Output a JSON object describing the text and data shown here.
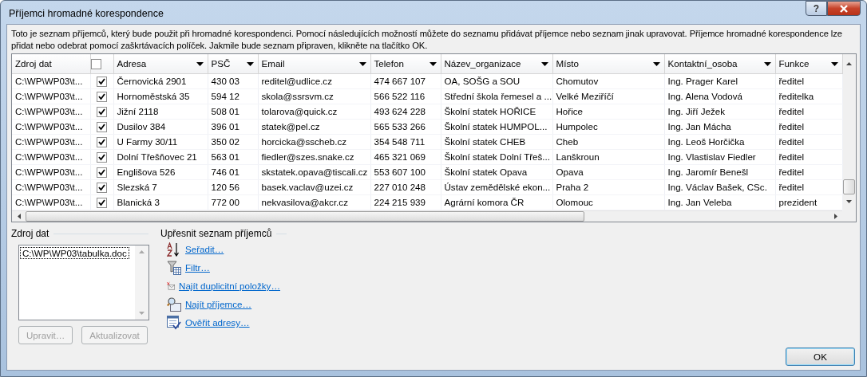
{
  "window": {
    "title": "Příjemci hromadné korespondence",
    "help_button": "?"
  },
  "description": "Toto je seznam příjemců, který bude použit při hromadné korespondenci. Pomocí následujících možností můžete do seznamu přidávat příjemce nebo seznam jinak upravovat. Příjemce hromadné korespondence lze přidat nebo odebrat pomocí zaškrtávacích políček. Jakmile bude seznam připraven, klikněte na tlačítko OK.",
  "table": {
    "columns": [
      {
        "kind": "plain",
        "label": "Zdroj dat"
      },
      {
        "kind": "check",
        "checked": false
      },
      {
        "kind": "filter",
        "label": "Adresa"
      },
      {
        "kind": "filter",
        "label": "PSČ"
      },
      {
        "kind": "filter",
        "label": "Email"
      },
      {
        "kind": "filter",
        "label": "Telefon"
      },
      {
        "kind": "filter",
        "label": "Název_organizace"
      },
      {
        "kind": "filter",
        "label": "Místo"
      },
      {
        "kind": "filter",
        "label": "Kontaktní_osoba"
      },
      {
        "kind": "filter",
        "label": "Funkce"
      }
    ],
    "rows": [
      {
        "included": true,
        "cells": [
          "C:\\WP\\WP03\\t...",
          "",
          "Černovická 2901",
          "430 03",
          "reditel@udlice.cz",
          "474 667 107",
          "OA, SOŠG a SOU",
          "Chomutov",
          "Ing. Prager Karel",
          "ředitel"
        ]
      },
      {
        "included": true,
        "cells": [
          "C:\\WP\\WP03\\t...",
          "",
          "Hornoměstská 35",
          "594 12",
          "skola@ssrsvm.cz",
          "566 522 116",
          "Střední škola řemesel a ...",
          "Velké Meziříčí",
          "Ing. Alena Vodová",
          "ředitelka"
        ]
      },
      {
        "included": true,
        "cells": [
          "C:\\WP\\WP03\\t...",
          "",
          "Jižní 2118",
          "508 01",
          "tolarova@quick.cz",
          "493 624 228",
          "Školní statek HOŘICE",
          "Hořice",
          "Ing. Jiří Ježek",
          "ředitel"
        ]
      },
      {
        "included": true,
        "cells": [
          "C:\\WP\\WP03\\t...",
          "",
          "Dusilov 384",
          "396 01",
          "statek@pel.cz",
          "565 533 266",
          "Školní statek HUMPOL...",
          "Humpolec",
          "Ing. Jan Mácha",
          "ředitel"
        ]
      },
      {
        "included": true,
        "cells": [
          "C:\\WP\\WP03\\t...",
          "",
          "U Farmy 30/11",
          "350 02",
          "horcicka@sscheb.cz",
          "354 548 711",
          "Školní statek CHEB",
          "Cheb",
          "Ing. Leoš Horčička",
          "ředitel"
        ]
      },
      {
        "included": true,
        "cells": [
          "C:\\WP\\WP03\\t...",
          "",
          "Dolní Třešňovec 21",
          "563 01",
          "fiedler@szes.snake.cz",
          "465 321 069",
          "Školní statek Dolní Třeš...",
          "Lanškroun",
          "Ing. Vlastislav Fiedler",
          "ředitel"
        ]
      },
      {
        "included": true,
        "cells": [
          "C:\\WP\\WP03\\t...",
          "",
          "Englišova 526",
          "746 01",
          "skstatek.opava@tiscali.cz",
          "553 607 100",
          "Školní statek Opava",
          "Opava",
          "Ing. Jaromír Benešl",
          "ředitel"
        ]
      },
      {
        "included": true,
        "cells": [
          "C:\\WP\\WP03\\t...",
          "",
          "Slezská 7",
          "120 56",
          "basek.vaclav@uzei.cz",
          "227 010 248",
          "Ústav zemědělské ekon...",
          "Praha 2",
          "Ing. Václav Bašek, CSc.",
          "ředitel"
        ]
      },
      {
        "included": true,
        "cells": [
          "C:\\WP\\WP03\\t...",
          "",
          "Blanická 3",
          "772 00",
          "nekvasilova@akcr.cz",
          "224 215 939",
          "Agrární komora ČR",
          "Olomouc",
          "Ing. Jan Veleba",
          "prezident"
        ]
      }
    ]
  },
  "data_source": {
    "label": "Zdroj dat",
    "items": [
      {
        "label": "C:\\WP\\WP03\\tabulka.doc",
        "selected": true
      }
    ],
    "buttons": [
      {
        "label": "Upravit…",
        "disabled": true
      },
      {
        "label": "Aktualizovat",
        "disabled": true
      }
    ]
  },
  "refine": {
    "label": "Upřesnit seznam příjemců",
    "links": [
      {
        "kind": "sort",
        "label": "Seřadit…"
      },
      {
        "kind": "filter",
        "label": "Filtr…"
      },
      {
        "kind": "duplicates",
        "label": "Najít duplicitní položky…"
      },
      {
        "kind": "find",
        "label": "Najít příjemce…"
      },
      {
        "kind": "verify",
        "label": "Ověřit adresy…"
      }
    ]
  },
  "ok_button": "OK"
}
